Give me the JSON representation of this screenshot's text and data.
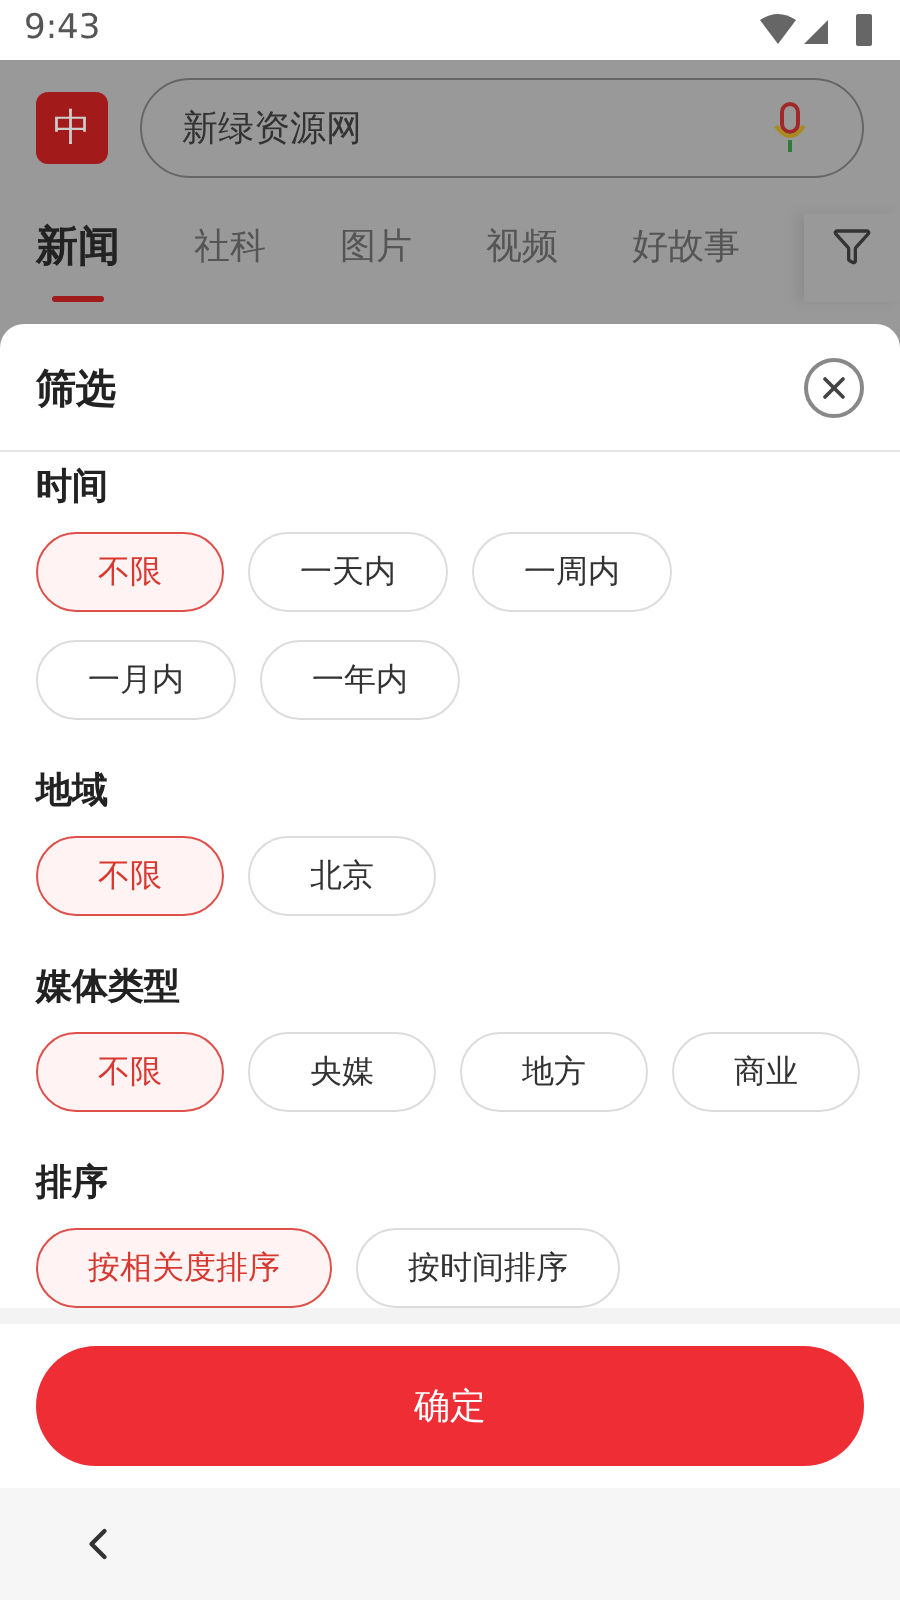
{
  "status_bar": {
    "time": "9:43"
  },
  "app": {
    "logo": "中",
    "search": {
      "value": "新绿资源网"
    },
    "tabs": [
      {
        "label": "新闻",
        "selected": true
      },
      {
        "label": "社科",
        "selected": false
      },
      {
        "label": "图片",
        "selected": false
      },
      {
        "label": "视频",
        "selected": false
      },
      {
        "label": "好故事",
        "selected": false
      }
    ]
  },
  "filter": {
    "title": "筛选",
    "sections": [
      {
        "title": "时间",
        "options": [
          {
            "label": "不限",
            "selected": true
          },
          {
            "label": "一天内",
            "selected": false
          },
          {
            "label": "一周内",
            "selected": false
          },
          {
            "label": "一月内",
            "selected": false
          },
          {
            "label": "一年内",
            "selected": false
          }
        ]
      },
      {
        "title": "地域",
        "options": [
          {
            "label": "不限",
            "selected": true
          },
          {
            "label": "北京",
            "selected": false
          }
        ]
      },
      {
        "title": "媒体类型",
        "options": [
          {
            "label": "不限",
            "selected": true
          },
          {
            "label": "央媒",
            "selected": false
          },
          {
            "label": "地方",
            "selected": false
          },
          {
            "label": "商业",
            "selected": false
          }
        ]
      },
      {
        "title": "排序",
        "options": [
          {
            "label": "按相关度排序",
            "selected": true
          },
          {
            "label": "按时间排序",
            "selected": false
          }
        ]
      }
    ],
    "confirm": "确定"
  }
}
